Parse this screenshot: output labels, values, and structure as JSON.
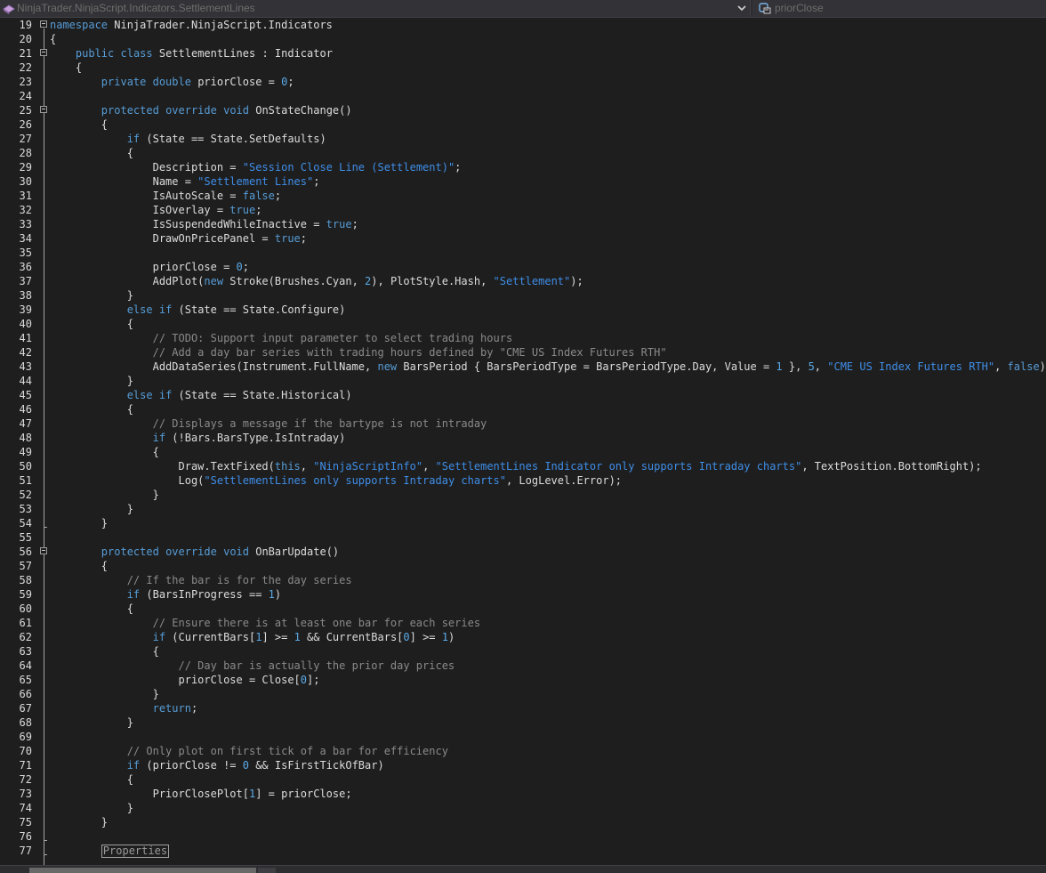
{
  "navbar": {
    "class_dropdown": "NinjaTrader.NinjaScript.Indicators.SettlementLines",
    "member_dropdown": "priorClose"
  },
  "editor": {
    "lines": [
      {
        "n": "19",
        "fold": true,
        "indent": 0,
        "segs": [
          [
            "namespace NinjaTrader.NinjaScript.Indicators",
            ""
          ]
        ]
      },
      {
        "n": "20",
        "fold": false,
        "indent": 0,
        "segs": [
          [
            "{",
            ""
          ]
        ]
      },
      {
        "n": "21",
        "fold": true,
        "indent": 4,
        "segs": [
          [
            "public class SettlementLines : Indicator",
            ""
          ]
        ]
      },
      {
        "n": "22",
        "fold": false,
        "indent": 4,
        "segs": [
          [
            "{",
            ""
          ]
        ]
      },
      {
        "n": "23",
        "fold": false,
        "indent": 8,
        "segs": [
          [
            "private double priorClose = ",
            ""
          ],
          [
            "0",
            "num"
          ],
          [
            ";",
            ""
          ]
        ]
      },
      {
        "n": "24",
        "fold": false,
        "indent": 0,
        "segs": []
      },
      {
        "n": "25",
        "fold": true,
        "indent": 8,
        "segs": [
          [
            "protected override void OnStateChange()",
            ""
          ]
        ]
      },
      {
        "n": "26",
        "fold": false,
        "indent": 8,
        "segs": [
          [
            "{",
            ""
          ]
        ]
      },
      {
        "n": "27",
        "fold": false,
        "indent": 12,
        "segs": [
          [
            "if (State == State.SetDefaults)",
            ""
          ]
        ]
      },
      {
        "n": "28",
        "fold": false,
        "indent": 12,
        "segs": [
          [
            "{",
            ""
          ]
        ]
      },
      {
        "n": "29",
        "fold": false,
        "indent": 16,
        "segs": [
          [
            "Description = ",
            ""
          ],
          [
            "\"Session Close Line (Settlement)\"",
            "str"
          ],
          [
            ";",
            ""
          ]
        ]
      },
      {
        "n": "30",
        "fold": false,
        "indent": 16,
        "segs": [
          [
            "Name = ",
            ""
          ],
          [
            "\"Settlement Lines\"",
            "str"
          ],
          [
            ";",
            ""
          ]
        ]
      },
      {
        "n": "31",
        "fold": false,
        "indent": 16,
        "segs": [
          [
            "IsAutoScale = false;",
            ""
          ]
        ]
      },
      {
        "n": "32",
        "fold": false,
        "indent": 16,
        "segs": [
          [
            "IsOverlay = true;",
            ""
          ]
        ]
      },
      {
        "n": "33",
        "fold": false,
        "indent": 16,
        "segs": [
          [
            "IsSuspendedWhileInactive = true;",
            ""
          ]
        ]
      },
      {
        "n": "34",
        "fold": false,
        "indent": 16,
        "segs": [
          [
            "DrawOnPricePanel = true;",
            ""
          ]
        ]
      },
      {
        "n": "35",
        "fold": false,
        "indent": 0,
        "segs": []
      },
      {
        "n": "36",
        "fold": false,
        "indent": 16,
        "segs": [
          [
            "priorClose = ",
            ""
          ],
          [
            "0",
            "num"
          ],
          [
            ";",
            ""
          ]
        ]
      },
      {
        "n": "37",
        "fold": false,
        "indent": 16,
        "segs": [
          [
            "AddPlot(new Stroke(Brushes.Cyan, ",
            ""
          ],
          [
            "2",
            "num"
          ],
          [
            "), PlotStyle.Hash, ",
            ""
          ],
          [
            "\"Settlement\"",
            "str"
          ],
          [
            ");",
            ""
          ]
        ]
      },
      {
        "n": "38",
        "fold": false,
        "indent": 12,
        "segs": [
          [
            "}",
            ""
          ]
        ]
      },
      {
        "n": "39",
        "fold": false,
        "indent": 12,
        "segs": [
          [
            "else if (State == State.Configure)",
            ""
          ]
        ]
      },
      {
        "n": "40",
        "fold": false,
        "indent": 12,
        "segs": [
          [
            "{",
            ""
          ]
        ]
      },
      {
        "n": "41",
        "fold": false,
        "indent": 16,
        "segs": [
          [
            "// TODO: Support input parameter to select trading hours",
            "com"
          ]
        ]
      },
      {
        "n": "42",
        "fold": false,
        "indent": 16,
        "segs": [
          [
            "// Add a day bar series with trading hours defined by \"CME US Index Futures RTH\"",
            "com"
          ]
        ]
      },
      {
        "n": "43",
        "fold": false,
        "indent": 16,
        "segs": [
          [
            "AddDataSeries(Instrument.FullName, new BarsPeriod { BarsPeriodType = BarsPeriodType.Day, Value = ",
            ""
          ],
          [
            "1",
            "num"
          ],
          [
            " }, ",
            ""
          ],
          [
            "5",
            "num"
          ],
          [
            ", ",
            ""
          ],
          [
            "\"CME US Index Futures RTH\"",
            "str"
          ],
          [
            ", false);",
            ""
          ]
        ]
      },
      {
        "n": "44",
        "fold": false,
        "indent": 12,
        "segs": [
          [
            "}",
            ""
          ]
        ]
      },
      {
        "n": "45",
        "fold": false,
        "indent": 12,
        "segs": [
          [
            "else if (State == State.Historical)",
            ""
          ]
        ]
      },
      {
        "n": "46",
        "fold": false,
        "indent": 12,
        "segs": [
          [
            "{",
            ""
          ]
        ]
      },
      {
        "n": "47",
        "fold": false,
        "indent": 16,
        "segs": [
          [
            "// Displays a message if the bartype is not intraday",
            "com"
          ]
        ]
      },
      {
        "n": "48",
        "fold": false,
        "indent": 16,
        "segs": [
          [
            "if (!Bars.BarsType.IsIntraday)",
            ""
          ]
        ]
      },
      {
        "n": "49",
        "fold": false,
        "indent": 16,
        "segs": [
          [
            "{",
            ""
          ]
        ]
      },
      {
        "n": "50",
        "fold": false,
        "indent": 20,
        "segs": [
          [
            "Draw.TextFixed(this, ",
            ""
          ],
          [
            "\"NinjaScriptInfo\"",
            "str"
          ],
          [
            ", ",
            ""
          ],
          [
            "\"SettlementLines Indicator only supports Intraday charts\"",
            "str"
          ],
          [
            ", TextPosition.BottomRight);",
            ""
          ]
        ]
      },
      {
        "n": "51",
        "fold": false,
        "indent": 20,
        "segs": [
          [
            "Log(",
            ""
          ],
          [
            "\"SettlementLines only supports Intraday charts\"",
            "str"
          ],
          [
            ", LogLevel.Error);",
            ""
          ]
        ]
      },
      {
        "n": "52",
        "fold": false,
        "indent": 16,
        "segs": [
          [
            "}",
            ""
          ]
        ]
      },
      {
        "n": "53",
        "fold": false,
        "indent": 12,
        "segs": [
          [
            "}",
            ""
          ]
        ]
      },
      {
        "n": "54",
        "fold": false,
        "indent": 8,
        "segs": [
          [
            "}",
            ""
          ]
        ]
      },
      {
        "n": "55",
        "fold": false,
        "indent": 0,
        "segs": []
      },
      {
        "n": "56",
        "fold": true,
        "indent": 8,
        "segs": [
          [
            "protected override void OnBarUpdate()",
            ""
          ]
        ]
      },
      {
        "n": "57",
        "fold": false,
        "indent": 8,
        "segs": [
          [
            "{",
            ""
          ]
        ]
      },
      {
        "n": "58",
        "fold": false,
        "indent": 12,
        "segs": [
          [
            "// If the bar is for the day series",
            "com"
          ]
        ]
      },
      {
        "n": "59",
        "fold": false,
        "indent": 12,
        "segs": [
          [
            "if (BarsInProgress == ",
            ""
          ],
          [
            "1",
            "num"
          ],
          [
            ")",
            ""
          ]
        ]
      },
      {
        "n": "60",
        "fold": false,
        "indent": 12,
        "segs": [
          [
            "{",
            ""
          ]
        ]
      },
      {
        "n": "61",
        "fold": false,
        "indent": 16,
        "segs": [
          [
            "// Ensure there is at least one bar for each series",
            "com"
          ]
        ]
      },
      {
        "n": "62",
        "fold": false,
        "indent": 16,
        "segs": [
          [
            "if (CurrentBars[",
            ""
          ],
          [
            "1",
            "num"
          ],
          [
            "] >= ",
            ""
          ],
          [
            "1",
            "num"
          ],
          [
            " && CurrentBars[",
            ""
          ],
          [
            "0",
            "num"
          ],
          [
            "] >= ",
            ""
          ],
          [
            "1",
            "num"
          ],
          [
            ")",
            ""
          ]
        ]
      },
      {
        "n": "63",
        "fold": false,
        "indent": 16,
        "segs": [
          [
            "{",
            ""
          ]
        ]
      },
      {
        "n": "64",
        "fold": false,
        "indent": 20,
        "segs": [
          [
            "// Day bar is actually the prior day prices",
            "com"
          ]
        ]
      },
      {
        "n": "65",
        "fold": false,
        "indent": 20,
        "segs": [
          [
            "priorClose = Close[",
            ""
          ],
          [
            "0",
            "num"
          ],
          [
            "];",
            ""
          ]
        ]
      },
      {
        "n": "66",
        "fold": false,
        "indent": 16,
        "segs": [
          [
            "}",
            ""
          ]
        ]
      },
      {
        "n": "67",
        "fold": false,
        "indent": 16,
        "segs": [
          [
            "return;",
            ""
          ]
        ]
      },
      {
        "n": "68",
        "fold": false,
        "indent": 12,
        "segs": [
          [
            "}",
            ""
          ]
        ]
      },
      {
        "n": "69",
        "fold": false,
        "indent": 0,
        "segs": []
      },
      {
        "n": "70",
        "fold": false,
        "indent": 12,
        "segs": [
          [
            "// Only plot on first tick of a bar for efficiency",
            "com"
          ]
        ]
      },
      {
        "n": "71",
        "fold": false,
        "indent": 12,
        "segs": [
          [
            "if (priorClose != ",
            ""
          ],
          [
            "0",
            "num"
          ],
          [
            " && IsFirstTickOfBar)",
            ""
          ]
        ]
      },
      {
        "n": "72",
        "fold": false,
        "indent": 12,
        "segs": [
          [
            "{",
            ""
          ]
        ]
      },
      {
        "n": "73",
        "fold": false,
        "indent": 16,
        "segs": [
          [
            "PriorClosePlot[",
            ""
          ],
          [
            "1",
            "num"
          ],
          [
            "] = priorClose;",
            ""
          ]
        ]
      },
      {
        "n": "74",
        "fold": false,
        "indent": 12,
        "segs": [
          [
            "}",
            ""
          ]
        ]
      },
      {
        "n": "75",
        "fold": false,
        "indent": 8,
        "segs": [
          [
            "}",
            ""
          ]
        ]
      },
      {
        "n": "76",
        "fold": false,
        "indent": 0,
        "segs": []
      },
      {
        "n": "77",
        "fold": false,
        "indent": 8,
        "segs": [
          [
            "Properties",
            "region"
          ]
        ]
      }
    ]
  },
  "colors": {
    "background": "#1e1e1e",
    "keyword": "#569cd6",
    "string": "#3f8ee8",
    "comment": "#8a8a8a",
    "number": "#5aa9e6"
  }
}
